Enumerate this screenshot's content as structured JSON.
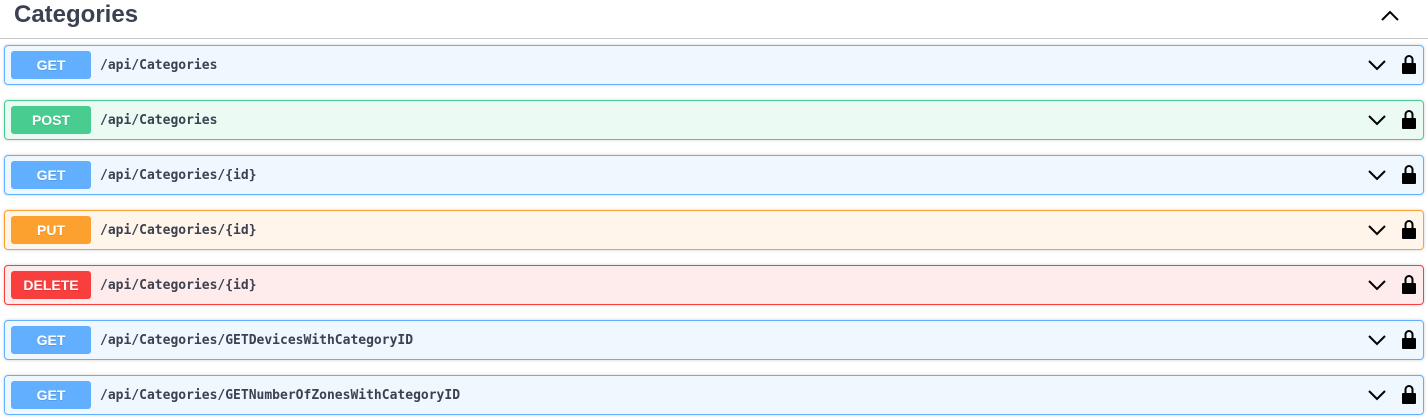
{
  "section": {
    "title": "Categories"
  },
  "operations": [
    {
      "method": "GET",
      "path": "/api/Categories"
    },
    {
      "method": "POST",
      "path": "/api/Categories"
    },
    {
      "method": "GET",
      "path": "/api/Categories/{id}"
    },
    {
      "method": "PUT",
      "path": "/api/Categories/{id}"
    },
    {
      "method": "DELETE",
      "path": "/api/Categories/{id}"
    },
    {
      "method": "GET",
      "path": "/api/Categories/GETDevicesWithCategoryID"
    },
    {
      "method": "GET",
      "path": "/api/Categories/GETNumberOfZonesWithCategoryID"
    }
  ],
  "colors": {
    "get": "#61affe",
    "post": "#49cc90",
    "put": "#fca130",
    "delete": "#f93e3e",
    "text": "#3b4151"
  },
  "icons": {
    "section_toggle": "chevron-up-icon",
    "operation_expand": "chevron-down-icon",
    "authorization": "lock-icon"
  }
}
